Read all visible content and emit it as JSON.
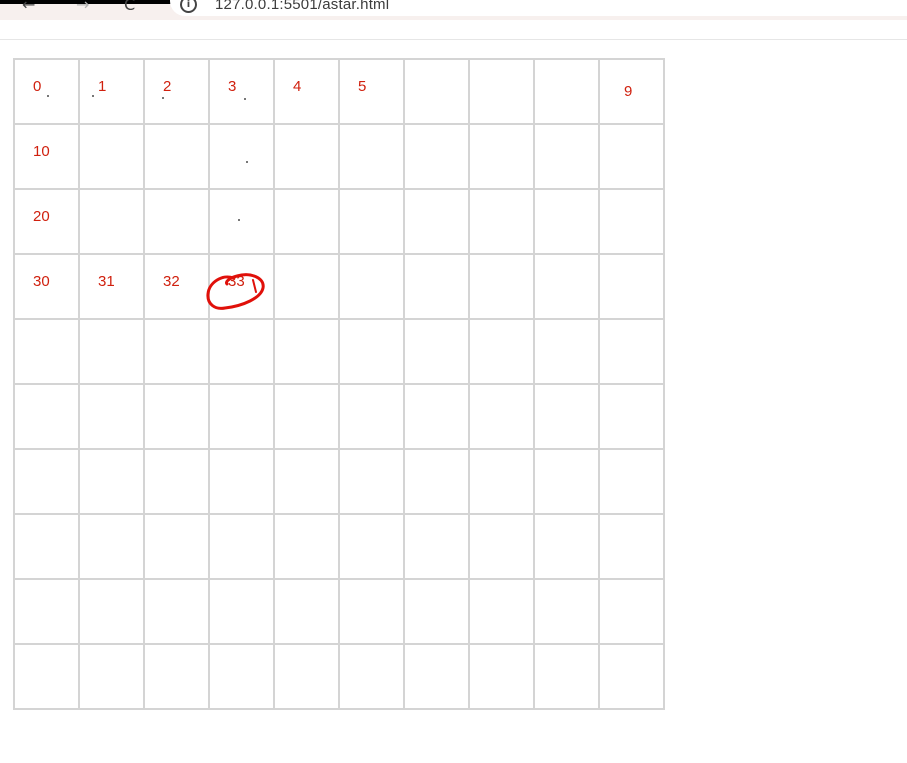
{
  "browser": {
    "back_icon": "←",
    "forward_icon": "→",
    "reload_icon": "C",
    "info_icon": "i",
    "url": "127.0.0.1:5501/astar.html"
  },
  "grid": {
    "rows": 10,
    "cols": 10,
    "labels": {
      "0": "0",
      "1": "1",
      "2": "2",
      "3": "3",
      "4": "4",
      "5": "5",
      "9": "9",
      "10": "10",
      "20": "20",
      "30": "30",
      "31": "31",
      "32": "32",
      "33": "33"
    },
    "highlighted_cell": 33
  },
  "colors": {
    "label": "#d0200e",
    "grid_line": "#d4d4d4",
    "annotation": "#e0100a"
  }
}
